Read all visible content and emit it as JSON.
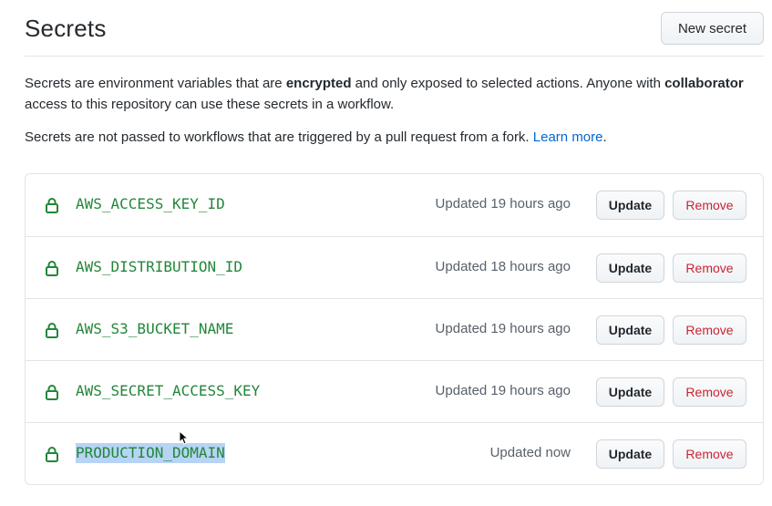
{
  "header": {
    "title": "Secrets",
    "new_secret_label": "New secret"
  },
  "description": {
    "p1_a": "Secrets are environment variables that are ",
    "p1_b": "encrypted",
    "p1_c": " and only exposed to selected actions. Anyone with ",
    "p1_d": "collaborator",
    "p1_e": " access to this repository can use these secrets in a workflow.",
    "p2_a": "Secrets are not passed to workflows that are triggered by a pull request from a fork. ",
    "p2_link": "Learn more",
    "p2_end": "."
  },
  "secrets": [
    {
      "name": "AWS_ACCESS_KEY_ID",
      "updated": "Updated 19 hours ago",
      "update_label": "Update",
      "remove_label": "Remove"
    },
    {
      "name": "AWS_DISTRIBUTION_ID",
      "updated": "Updated 18 hours ago",
      "update_label": "Update",
      "remove_label": "Remove"
    },
    {
      "name": "AWS_S3_BUCKET_NAME",
      "updated": "Updated 19 hours ago",
      "update_label": "Update",
      "remove_label": "Remove"
    },
    {
      "name": "AWS_SECRET_ACCESS_KEY",
      "updated": "Updated 19 hours ago",
      "update_label": "Update",
      "remove_label": "Remove"
    },
    {
      "name": "PRODUCTION_DOMAIN",
      "updated": "Updated now",
      "update_label": "Update",
      "remove_label": "Remove",
      "selected": true
    }
  ],
  "colors": {
    "secret_name": "#22863a",
    "link": "#0366d6",
    "remove": "#cb2431",
    "selection": "#b7d4f4"
  },
  "icons": {
    "lock": "lock-icon",
    "cursor": "mouse-cursor-icon"
  }
}
